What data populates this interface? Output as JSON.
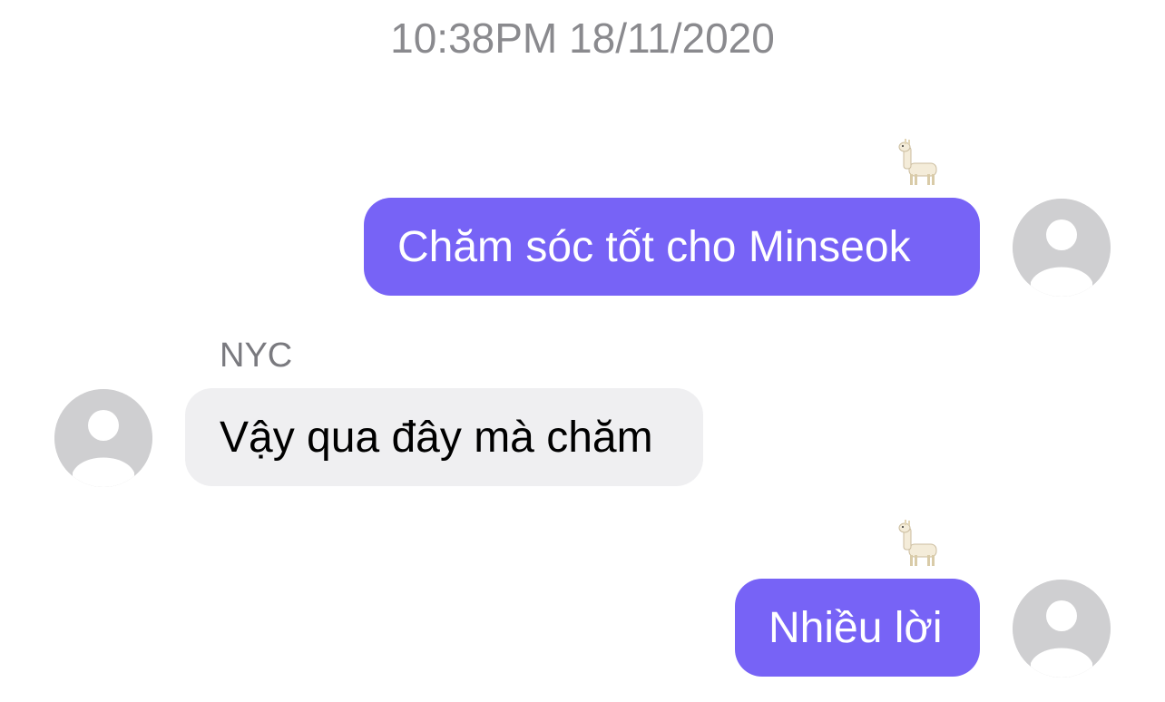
{
  "timestamp": "10:38PM 18/11/2020",
  "messages": [
    {
      "direction": "out",
      "text": "Chăm sóc tốt cho Minseok",
      "reaction": "llama-emoji"
    },
    {
      "direction": "in",
      "sender": "NYC",
      "text": "Vậy qua đây mà chăm"
    },
    {
      "direction": "out",
      "text": "Nhiều lời",
      "reaction": "llama-emoji"
    }
  ],
  "colors": {
    "outgoing_bubble": "#7763f6",
    "incoming_bubble": "#efeff1",
    "timestamp_text": "#8a8a8e",
    "avatar_bg": "#cfcfd1"
  },
  "icons": {
    "avatar": "default-user-avatar-icon",
    "reaction": "llama-emoji-icon"
  }
}
